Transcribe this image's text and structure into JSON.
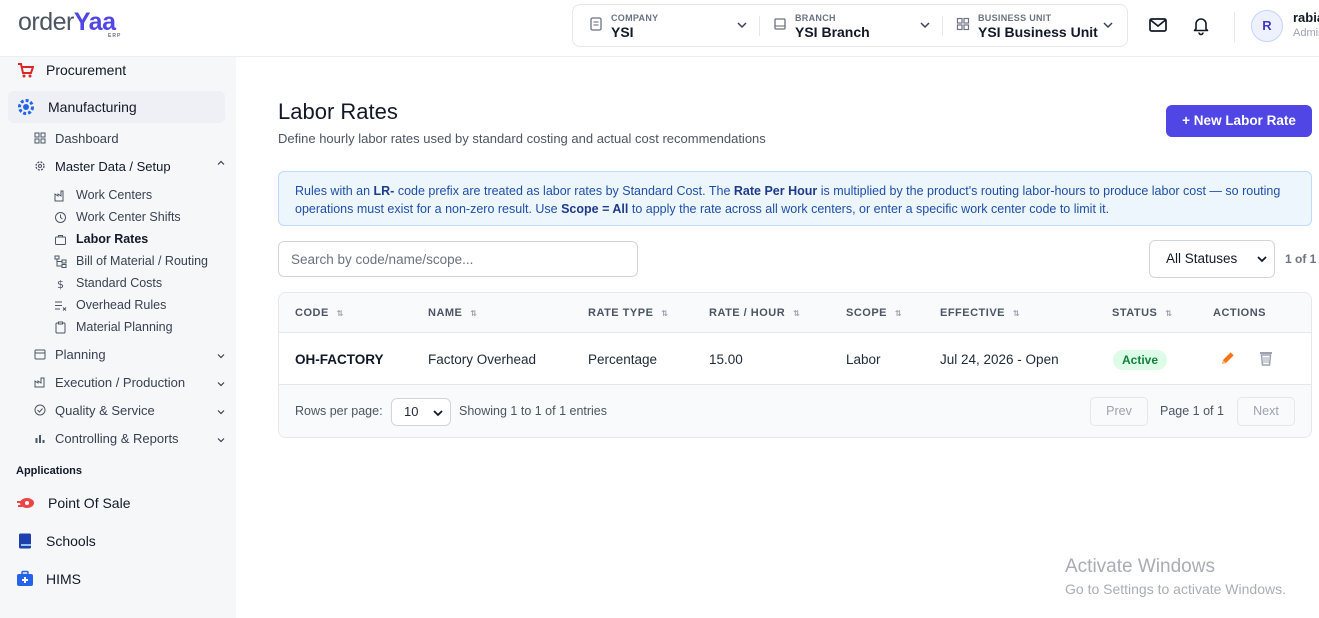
{
  "app": {
    "logo_main": "order",
    "logo_accent": "Yaa",
    "logo_sub": "ERP"
  },
  "header": {
    "company": {
      "label": "COMPANY",
      "value": "YSI"
    },
    "branch": {
      "label": "BRANCH",
      "value": "YSI Branch"
    },
    "business_unit": {
      "label": "BUSINESS UNIT",
      "value": "YSI Business Unit"
    },
    "user": {
      "initial": "R",
      "name": "rabia",
      "role": "Admin"
    }
  },
  "sidebar": {
    "procurement": "Procurement",
    "manufacturing": "Manufacturing",
    "dashboard": "Dashboard",
    "master_data": "Master Data / Setup",
    "sub_items": [
      "Work Centers",
      "Work Center Shifts",
      "Labor Rates",
      "Bill of Material / Routing",
      "Standard Costs",
      "Overhead Rules",
      "Material Planning"
    ],
    "planning": "Planning",
    "execution": "Execution / Production",
    "quality": "Quality & Service",
    "controlling": "Controlling & Reports",
    "applications_label": "Applications",
    "apps": [
      "Point Of Sale",
      "Schools",
      "HIMS"
    ]
  },
  "page": {
    "title": "Labor Rates",
    "subtitle": "Define hourly labor rates used by standard costing and actual cost recommendations",
    "new_button": "+ New Labor Rate"
  },
  "info": {
    "p1": "Rules with an ",
    "b1": "LR-",
    "p2": " code prefix are treated as labor rates by Standard Cost. The ",
    "b2": "Rate Per Hour",
    "p3": " is multiplied by the product's routing labor-hours to produce labor cost — so routing operations must exist for a non-zero result. Use ",
    "b3": "Scope = All",
    "p4": " to apply the rate across all work centers, or enter a specific work center code to limit it."
  },
  "filters": {
    "search_placeholder": "Search by code/name/scope...",
    "status_value": "All Statuses",
    "page_count": "1 of 1"
  },
  "table": {
    "headers": [
      "CODE",
      "NAME",
      "RATE TYPE",
      "RATE / HOUR",
      "SCOPE",
      "EFFECTIVE",
      "STATUS",
      "ACTIONS"
    ],
    "rows": [
      {
        "code": "OH-FACTORY",
        "name": "Factory Overhead",
        "rate_type": "Percentage",
        "rate_hour": "15.00",
        "scope": "Labor",
        "effective": "Jul 24, 2026 - Open",
        "status": "Active"
      }
    ]
  },
  "footer": {
    "rows_label": "Rows per page:",
    "rows_value": "10",
    "showing": "Showing 1 to 1 of 1 entries",
    "prev": "Prev",
    "page_info": "Page 1 of 1",
    "next": "Next"
  },
  "watermark": {
    "line1": "Activate Windows",
    "line2": "Go to Settings to activate Windows."
  },
  "colors": {
    "accent": "#4f46e5",
    "active_badge": "#dcfce7",
    "info_bg": "#eef6fd",
    "edit_icon": "#f97316"
  }
}
